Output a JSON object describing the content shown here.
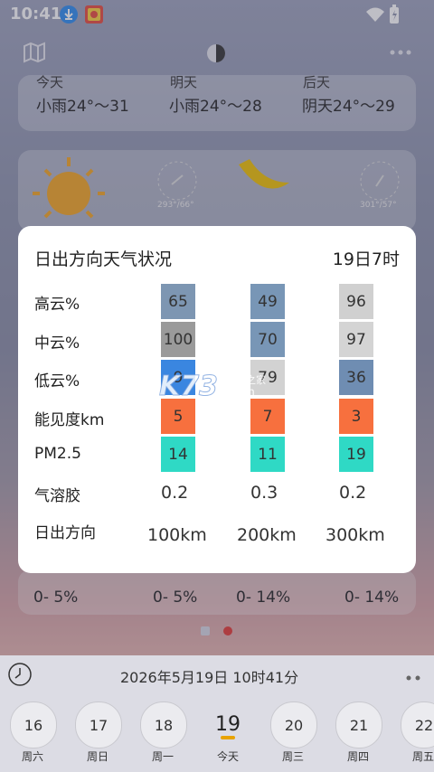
{
  "status_bar": {
    "time": "10:41"
  },
  "forecast_cards": [
    {
      "head": "今天",
      "text": "小雨24°～31"
    },
    {
      "head": "明天",
      "text": "小雨24°～28"
    },
    {
      "head": "后天",
      "text": "阴天24°～29"
    }
  ],
  "sun_cards": [
    {
      "angles": "293°/66°"
    },
    {
      "angles": "301°/57°"
    }
  ],
  "precip_row": [
    "0- 5%",
    "0- 5%",
    "0- 14%",
    "0- 14%"
  ],
  "modal": {
    "title": "日出方向天气状况",
    "date": "19日7时",
    "rows": [
      {
        "label": "高云%",
        "values": [
          "65",
          "49",
          "96"
        ]
      },
      {
        "label": "中云%",
        "values": [
          "100",
          "70",
          "97"
        ]
      },
      {
        "label": "低云%",
        "values": [
          "9",
          "79",
          "36"
        ]
      },
      {
        "label": "能见度km",
        "values": [
          "5",
          "7",
          "3"
        ]
      },
      {
        "label": "PM2.5",
        "values": [
          "14",
          "11",
          "19"
        ]
      },
      {
        "label": "气溶胶",
        "values": [
          "0.2",
          "0.3",
          "0.2"
        ]
      }
    ],
    "direction_label": "日出方向",
    "distances": [
      "100km",
      "200km",
      "300km"
    ],
    "cell_colors": [
      [
        "#7d96b2",
        "#7896b6",
        "#d0d0d0"
      ],
      [
        "#9a9a9a",
        "#7896b6",
        "#d4d4d4"
      ],
      [
        "#3a86e0",
        "#d2d2d2",
        "#6f8db2"
      ],
      [
        "#f7703e",
        "#f7703e",
        "#f7703e"
      ],
      [
        "#2fd9c5",
        "#2fd9c5",
        "#2fd9c5"
      ]
    ]
  },
  "watermark": {
    "brand": "K73",
    "sub": "游戏之家",
    "domain": ".com"
  },
  "datetime_bar": {
    "text": "2026年5月19日  10时41分"
  },
  "days": [
    {
      "num": "16",
      "dow": "周六"
    },
    {
      "num": "17",
      "dow": "周日"
    },
    {
      "num": "18",
      "dow": "周一"
    },
    {
      "num": "19",
      "dow": "今天"
    },
    {
      "num": "20",
      "dow": "周三"
    },
    {
      "num": "21",
      "dow": "周四"
    },
    {
      "num": "22",
      "dow": "周五"
    }
  ]
}
